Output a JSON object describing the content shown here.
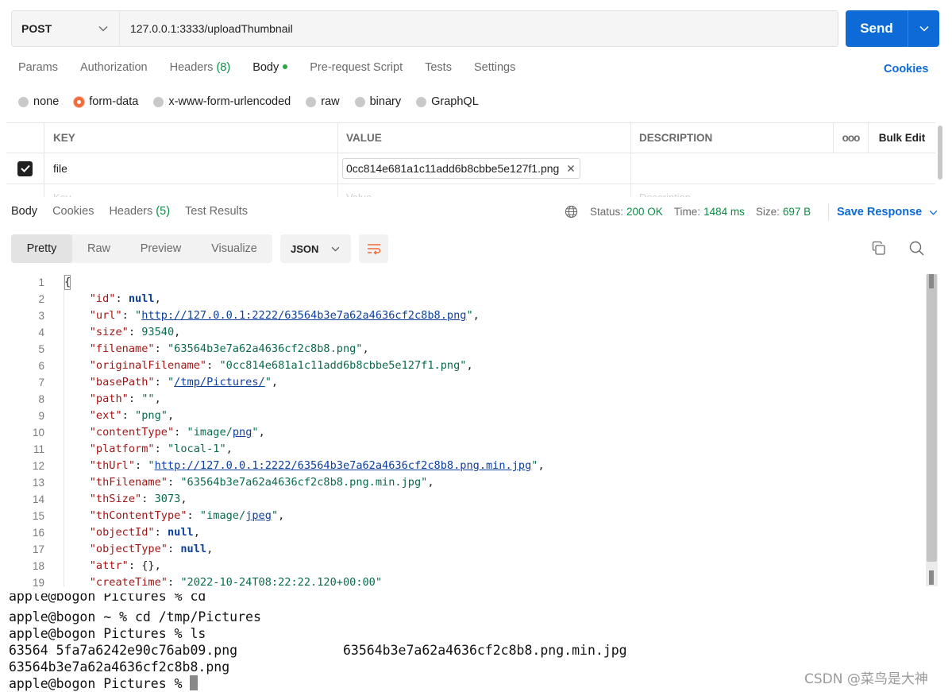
{
  "request": {
    "method": "POST",
    "url": "127.0.0.1:3333/uploadThumbnail",
    "send_label": "Send"
  },
  "request_tabs": {
    "params": "Params",
    "authorization": "Authorization",
    "headers": "Headers",
    "headers_count": "(8)",
    "body": "Body",
    "prerequest": "Pre-request Script",
    "tests": "Tests",
    "settings": "Settings",
    "cookies": "Cookies"
  },
  "body_types": [
    "none",
    "form-data",
    "x-www-form-urlencoded",
    "raw",
    "binary",
    "GraphQL"
  ],
  "body_type_selected": "form-data",
  "form_table": {
    "headers": {
      "key": "KEY",
      "value": "VALUE",
      "description": "DESCRIPTION",
      "more": "ooo",
      "bulk_edit": "Bulk Edit"
    },
    "rows": [
      {
        "checked": true,
        "key": "file",
        "value": "0cc814e681a1c11add6b8cbbe5e127f1.png",
        "description": ""
      }
    ],
    "placeholder": {
      "key": "Key",
      "value": "Value",
      "description": "Description"
    }
  },
  "response": {
    "tabs": {
      "body": "Body",
      "cookies": "Cookies",
      "headers": "Headers",
      "headers_count": "(5)",
      "test_results": "Test Results"
    },
    "status_label": "Status:",
    "status_value": "200 OK",
    "time_label": "Time:",
    "time_value": "1484 ms",
    "size_label": "Size:",
    "size_value": "697 B",
    "save_label": "Save Response"
  },
  "viewer": {
    "modes": [
      "Pretty",
      "Raw",
      "Preview",
      "Visualize"
    ],
    "active_mode": "Pretty",
    "format": "JSON"
  },
  "code_lines": [
    {
      "n": "1",
      "html": "{"
    },
    {
      "n": "2",
      "html": "    <span class=\"k\">\"id\"</span>: <span class=\"nl\">null</span>,"
    },
    {
      "n": "3",
      "html": "    <span class=\"k\">\"url\"</span>: <span class=\"s\">\"<span class=\"u\">http://127.0.0.1:2222/63564b3e7a62a4636cf2c8b8.png</span>\"</span>,"
    },
    {
      "n": "4",
      "html": "    <span class=\"k\">\"size\"</span>: <span class=\"n\">93540</span>,"
    },
    {
      "n": "5",
      "html": "    <span class=\"k\">\"filename\"</span>: <span class=\"s\">\"63564b3e7a62a4636cf2c8b8.png\"</span>,"
    },
    {
      "n": "6",
      "html": "    <span class=\"k\">\"originalFilename\"</span>: <span class=\"s\">\"0cc814e681a1c11add6b8cbbe5e127f1.png\"</span>,"
    },
    {
      "n": "7",
      "html": "    <span class=\"k\">\"basePath\"</span>: <span class=\"s\">\"<span class=\"u\">/tmp/Pictures/</span>\"</span>,"
    },
    {
      "n": "8",
      "html": "    <span class=\"k\">\"path\"</span>: <span class=\"s\">\"\"</span>,"
    },
    {
      "n": "9",
      "html": "    <span class=\"k\">\"ext\"</span>: <span class=\"s\">\"png\"</span>,"
    },
    {
      "n": "10",
      "html": "    <span class=\"k\">\"contentType\"</span>: <span class=\"s\">\"image/<span class=\"u\">png</span>\"</span>,"
    },
    {
      "n": "11",
      "html": "    <span class=\"k\">\"platform\"</span>: <span class=\"s\">\"local-1\"</span>,"
    },
    {
      "n": "12",
      "html": "    <span class=\"k\">\"thUrl\"</span>: <span class=\"s\">\"<span class=\"u\">http://127.0.0.1:2222/63564b3e7a62a4636cf2c8b8.png.min.jpg</span>\"</span>,"
    },
    {
      "n": "13",
      "html": "    <span class=\"k\">\"thFilename\"</span>: <span class=\"s\">\"63564b3e7a62a4636cf2c8b8.png.min.jpg\"</span>,"
    },
    {
      "n": "14",
      "html": "    <span class=\"k\">\"thSize\"</span>: <span class=\"n\">3073</span>,"
    },
    {
      "n": "15",
      "html": "    <span class=\"k\">\"thContentType\"</span>: <span class=\"s\">\"image/<span class=\"u\">jpeg</span>\"</span>,"
    },
    {
      "n": "16",
      "html": "    <span class=\"k\">\"objectId\"</span>: <span class=\"nl\">null</span>,"
    },
    {
      "n": "17",
      "html": "    <span class=\"k\">\"objectType\"</span>: <span class=\"nl\">null</span>,"
    },
    {
      "n": "18",
      "html": "    <span class=\"k\">\"attr\"</span>: {},"
    },
    {
      "n": "19",
      "html": "    <span class=\"k\">\"createTime\"</span>: <span class=\"s\">\"2022-10-24T08:22:22.120+00:00\"</span>"
    }
  ],
  "terminal": {
    "lines": [
      "apple@bogon Pictures % cd",
      "apple@bogon ~ % cd /tmp/Pictures",
      "apple@bogon Pictures % ls",
      "63564 5fa7a6242e90c76ab09.png",
      "63564b3e7a62a4636cf2c8b8.png",
      "apple@bogon Pictures % "
    ],
    "ls_col2": "63564b3e7a62a4636cf2c8b8.png.min.jpg"
  },
  "watermark": "CSDN @菜鸟是大神",
  "colors": {
    "accent": "#0d6ad6",
    "status_ok": "#0a8c44",
    "radio_on": "#f26b3a"
  }
}
